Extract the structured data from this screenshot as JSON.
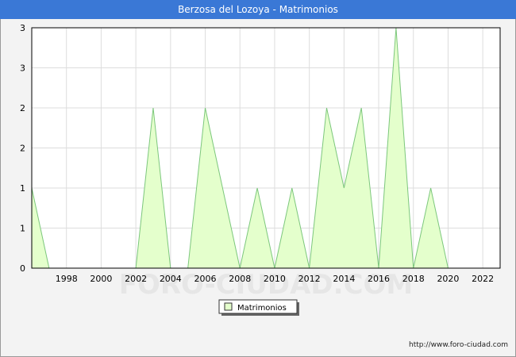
{
  "header": {
    "title": "Berzosa del Lozoya - Matrimonios"
  },
  "footer": {
    "url": "http://www.foro-ciudad.com"
  },
  "watermark": "FORO-CIUDAD.COM",
  "colors": {
    "title_bg": "#3a78d6",
    "fill": "#e4ffcc",
    "line": "#7cc77c",
    "grid": "#dddddd"
  },
  "chart_data": {
    "type": "area",
    "title": "Berzosa del Lozoya - Matrimonios",
    "xlabel": "",
    "ylabel": "",
    "x": [
      1996,
      1997,
      1998,
      1999,
      2000,
      2001,
      2002,
      2003,
      2004,
      2005,
      2006,
      2007,
      2008,
      2009,
      2010,
      2011,
      2012,
      2013,
      2014,
      2015,
      2016,
      2017,
      2018,
      2019,
      2020,
      2021,
      2022
    ],
    "series": [
      {
        "name": "Matrimonios",
        "values": [
          1,
          0,
          0,
          0,
          0,
          0,
          0,
          2,
          0,
          0,
          2,
          1,
          0,
          1,
          0,
          1,
          0,
          2,
          1,
          2,
          0,
          3,
          0,
          1,
          0,
          0,
          0
        ]
      }
    ],
    "xlim": [
      1996,
      2023
    ],
    "ylim": [
      0,
      3
    ],
    "x_ticks": [
      "1998",
      "2000",
      "2002",
      "2004",
      "2006",
      "2008",
      "2010",
      "2012",
      "2014",
      "2016",
      "2018",
      "2020",
      "2022"
    ],
    "y_tick_values": [
      0,
      0.5,
      1,
      1.5,
      2,
      2.5,
      3
    ],
    "y_tick_labels": [
      "0",
      "1",
      "1",
      "2",
      "2",
      "3",
      "3"
    ],
    "grid": true,
    "legend": "bottom-center"
  }
}
